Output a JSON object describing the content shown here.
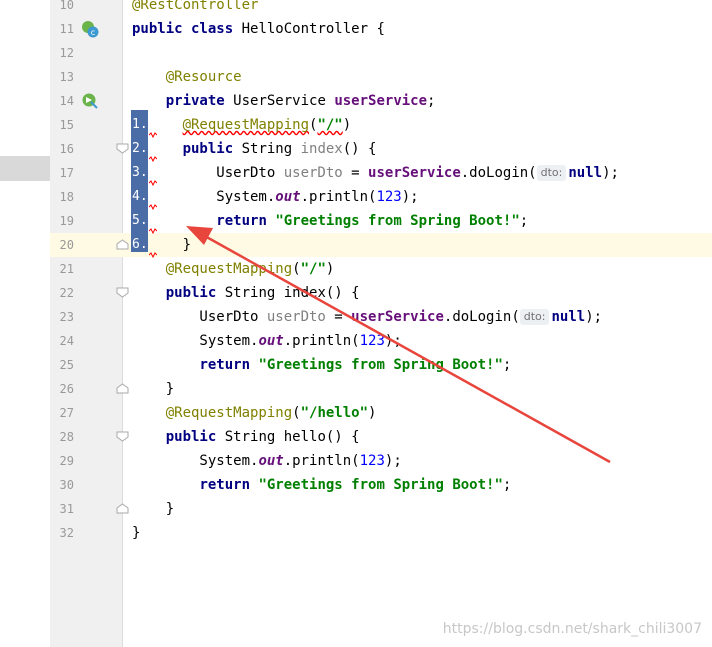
{
  "editor": {
    "lines": [
      {
        "n": "10",
        "html": "<span class=\"a\">@RestController</span>"
      },
      {
        "n": "11",
        "html": "<span class=\"k\">public class</span> HelloController {"
      },
      {
        "n": "12",
        "html": ""
      },
      {
        "n": "13",
        "html": "    <span class=\"a\">@Resource</span>"
      },
      {
        "n": "14",
        "html": "    <span class=\"k\">private</span> UserService <span class=\"f\">userService</span>;"
      },
      {
        "n": "15",
        "html": "      <span class=\"a err\">@RequestMapping</span>(<span class=\"s err\">\"/\"</span>)"
      },
      {
        "n": "16",
        "html": "      <span class=\"k\">public</span> String <span class=\"p\">index</span>() {"
      },
      {
        "n": "17",
        "html": "          UserDto <span class=\"p\">userDto</span> = <span class=\"f\">userService</span>.doLogin(<span class=\"hint\">dto:</span><span class=\"k\">null</span>);"
      },
      {
        "n": "18",
        "html": "          System.<span class=\"st\">out</span>.println(<span class=\"n\">123</span>);"
      },
      {
        "n": "19",
        "html": "          <span class=\"k\">return</span> <span class=\"s\">\"Greetings from Spring Boot!\"</span>;"
      },
      {
        "n": "20",
        "html": "      }"
      },
      {
        "n": "21",
        "html": "    <span class=\"a\">@RequestMapping</span>(<span class=\"s\">\"/\"</span>)"
      },
      {
        "n": "22",
        "html": "    <span class=\"k\">public</span> String index() {"
      },
      {
        "n": "23",
        "html": "        UserDto <span class=\"p\">userDto</span> = <span class=\"f\">userService</span>.doLogin(<span class=\"hint\">dto:</span><span class=\"k\">null</span>);"
      },
      {
        "n": "24",
        "html": "        System.<span class=\"st\">out</span>.println(<span class=\"n\">123</span>);"
      },
      {
        "n": "25",
        "html": "        <span class=\"k\">return</span> <span class=\"s\">\"Greetings from Spring Boot!\"</span>;"
      },
      {
        "n": "26",
        "html": "    }"
      },
      {
        "n": "27",
        "html": "    <span class=\"a\">@RequestMapping</span>(<span class=\"s\">\"/hello\"</span>)"
      },
      {
        "n": "28",
        "html": "    <span class=\"k\">public</span> String hello() {"
      },
      {
        "n": "29",
        "html": "        System.<span class=\"st\">out</span>.println(<span class=\"n\">123</span>);"
      },
      {
        "n": "30",
        "html": "        <span class=\"k\">return</span> <span class=\"s\">\"Greetings from Spring Boot!\"</span>;"
      },
      {
        "n": "31",
        "html": "    }"
      },
      {
        "n": "32",
        "html": "}"
      }
    ],
    "caret_line": "20",
    "selection_numbers": [
      "1.",
      "2.",
      "3.",
      "4.",
      "5.",
      "6."
    ]
  },
  "icons": {
    "class_icon": "spring-bean-class-icon",
    "resource_icon": "spring-injection-icon",
    "fold_icon": "fold-marker-icon"
  },
  "colors": {
    "keyword": "#000080",
    "annotation": "#808000",
    "string": "#008000",
    "field": "#660e7a",
    "number": "#0000ff",
    "selection": "#4a6da7",
    "caret_line": "#fffae3",
    "arrow": "#e8453c"
  },
  "watermark": "https://blog.csdn.net/shark_chili3007"
}
